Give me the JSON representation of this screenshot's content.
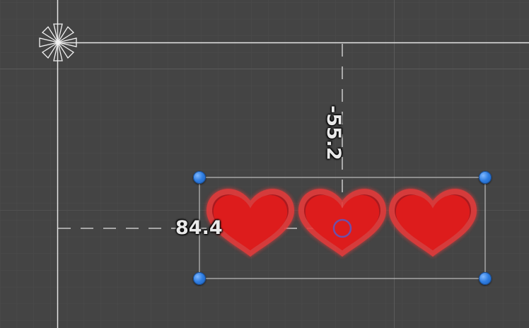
{
  "offsets": {
    "x_label": "84.4",
    "y_label": "-55.2"
  },
  "hearts": {
    "count": 3,
    "color": "#dd1c1c"
  },
  "colors": {
    "background": "#444444",
    "grid": "#4d4d4d",
    "guide": "#d8d8d8",
    "handle": "#2f7de1",
    "pivot": "#6f4fa8"
  },
  "icons": {
    "anchor": "anchor-flower-icon",
    "pivot": "pivot-circle-icon",
    "handles": "resize-handle-icon"
  }
}
